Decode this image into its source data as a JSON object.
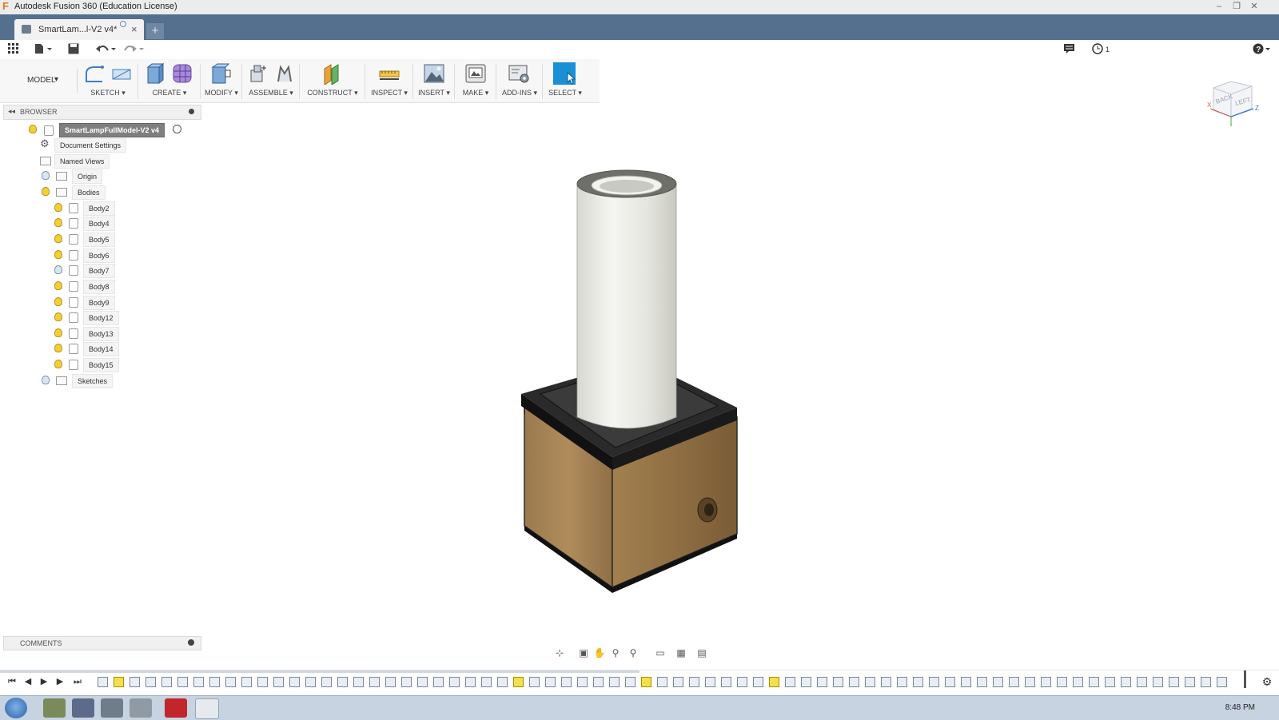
{
  "window": {
    "title": "Autodesk Fusion 360 (Education License)"
  },
  "tab": {
    "label": "SmartLam...l-V2 v4*"
  },
  "qat": {
    "history_count": "1"
  },
  "ribbon": {
    "mode": "MODEL",
    "groups": [
      {
        "label": "SKETCH ▾"
      },
      {
        "label": "CREATE ▾"
      },
      {
        "label": "MODIFY ▾"
      },
      {
        "label": "ASSEMBLE ▾"
      },
      {
        "label": "CONSTRUCT ▾"
      },
      {
        "label": "INSPECT ▾"
      },
      {
        "label": "INSERT ▾"
      },
      {
        "label": "MAKE ▾"
      },
      {
        "label": "ADD-INS ▾"
      },
      {
        "label": "SELECT ▾"
      }
    ]
  },
  "browser": {
    "title": "BROWSER",
    "root": "SmartLampFullModel-V2 v4",
    "items": [
      "Document Settings",
      "Named Views",
      "Origin",
      "Bodies",
      "Body2",
      "Body4",
      "Body5",
      "Body6",
      "Body7",
      "Body8",
      "Body9",
      "Body12",
      "Body13",
      "Body14",
      "Body15",
      "Sketches"
    ]
  },
  "comments": {
    "title": "COMMENTS"
  },
  "viewcube": {
    "back": "BACK",
    "left": "LEFT",
    "x": "X",
    "z": "Z"
  },
  "taskbar": {
    "time": "8:48 PM"
  },
  "colors": {
    "tab_bar": "#556f8e",
    "select_accent": "#1a8fd6",
    "bulb_on": "#f4cf33"
  }
}
